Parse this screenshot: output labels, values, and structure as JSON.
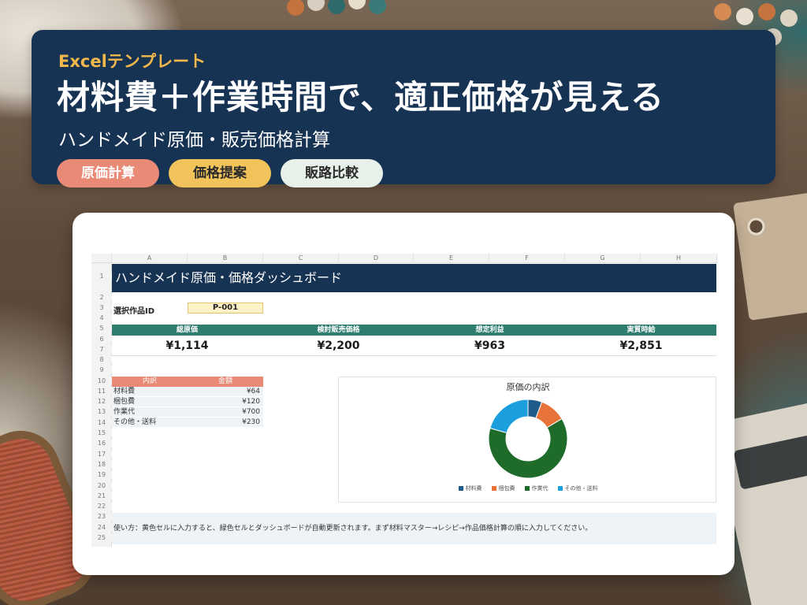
{
  "banner": {
    "eyebrow": "Excelテンプレート",
    "headline": "材料費＋作業時間で、適正価格が見える",
    "subhead": "ハンドメイド原価・販売価格計算",
    "pills": [
      "原価計算",
      "価格提案",
      "販路比較"
    ]
  },
  "sheet": {
    "columns": [
      "A",
      "B",
      "C",
      "D",
      "E",
      "F",
      "G",
      "H"
    ],
    "rows": [
      "1",
      "2",
      "3",
      "4",
      "5",
      "6",
      "7",
      "8",
      "9",
      "10",
      "11",
      "12",
      "13",
      "14",
      "15",
      "16",
      "17",
      "18",
      "19",
      "20",
      "21",
      "22",
      "23",
      "24",
      "25"
    ],
    "title": "ハンドメイド原価・価格ダッシュボード",
    "select_label": "選択作品ID",
    "select_value": "P-001",
    "kpis": [
      {
        "label": "総原価",
        "value": "¥1,114"
      },
      {
        "label": "検討販売価格",
        "value": "¥2,200"
      },
      {
        "label": "想定利益",
        "value": "¥963"
      },
      {
        "label": "実質時給",
        "value": "¥2,851"
      }
    ],
    "breakdown_headers": [
      "内訳",
      "金額"
    ],
    "breakdown": [
      {
        "name": "材料費",
        "amount": "¥64"
      },
      {
        "name": "梱包費",
        "amount": "¥120"
      },
      {
        "name": "作業代",
        "amount": "¥700"
      },
      {
        "name": "その他・送料",
        "amount": "¥230"
      }
    ],
    "note": "使い方：黄色セルに入力すると、緑色セルとダッシュボードが自動更新されます。まず材料マスター→レシピ→作品価格計算の順に入力してください。"
  },
  "chart_data": {
    "type": "pie",
    "title": "原価の内訳",
    "categories": [
      "材料費",
      "梱包費",
      "作業代",
      "その他・送料"
    ],
    "values": [
      64,
      120,
      700,
      230
    ],
    "colors": [
      "#1f5c8a",
      "#e8733a",
      "#1e6b2a",
      "#1ca0dd"
    ],
    "legend": "bottom",
    "donut": true
  },
  "colors": {
    "navy": "#173354",
    "teal": "#2e7d6e",
    "salmon": "#e88a75",
    "gold": "#f2c35a"
  }
}
